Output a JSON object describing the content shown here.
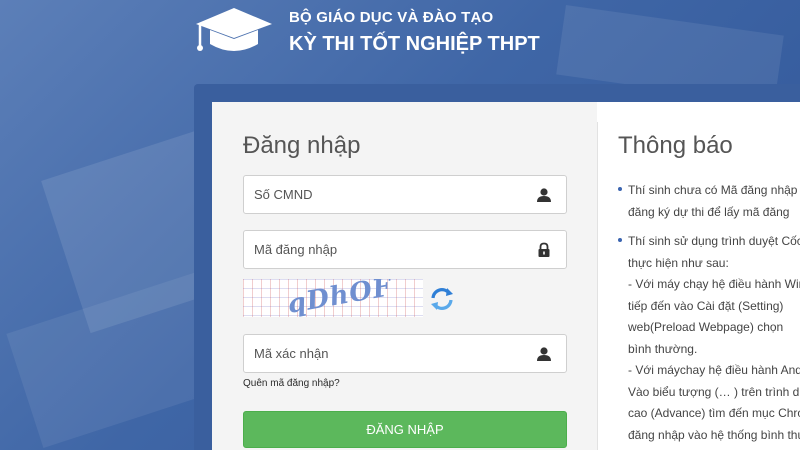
{
  "header": {
    "org_name": "BỘ GIÁO DỤC VÀ ĐÀO TẠO",
    "exam_name": "KỲ THI TỐT NGHIỆP THPT",
    "logo_icon": "graduation-cap-icon"
  },
  "login": {
    "title": "Đăng nhập",
    "id_field": {
      "placeholder": "Số CMND",
      "value": "",
      "icon": "user-icon"
    },
    "password_field": {
      "placeholder": "Mã đăng nhập",
      "value": "",
      "icon": "lock-icon"
    },
    "captcha": {
      "text": "qDhOF",
      "refresh_icon": "refresh-icon"
    },
    "captcha_field": {
      "placeholder": "Mã xác nhận",
      "value": "",
      "icon": "user-icon"
    },
    "forgot_link": "Quên mã đăng nhập?",
    "submit_label": "ĐĂNG NHẬP"
  },
  "notice": {
    "title": "Thông báo",
    "items": [
      {
        "lines": [
          "Thí sinh chưa có Mã đăng nhập",
          "đăng ký dự thi để lấy mã đăng"
        ]
      },
      {
        "lines": [
          "Thí sinh sử dụng trình duyệt Cốc Cốc",
          "thực hiện như sau:",
          " - Với máy chạy hệ điều hành Windows",
          "tiếp đến vào Cài đặt (Setting)",
          "web(Preload Webpage) chọn",
          "bình thường.",
          " - Với máychay hệ điều hành Android",
          "Vào biểu tượng (… ) trên trình duyệt",
          "cao (Advance) tìm đến mục Chrome",
          "đăng nhập vào hệ thống bình thường"
        ]
      }
    ]
  },
  "colors": {
    "background": "#3f66a6",
    "primary_button": "#5cb85c",
    "bullet": "#3a64b0"
  }
}
